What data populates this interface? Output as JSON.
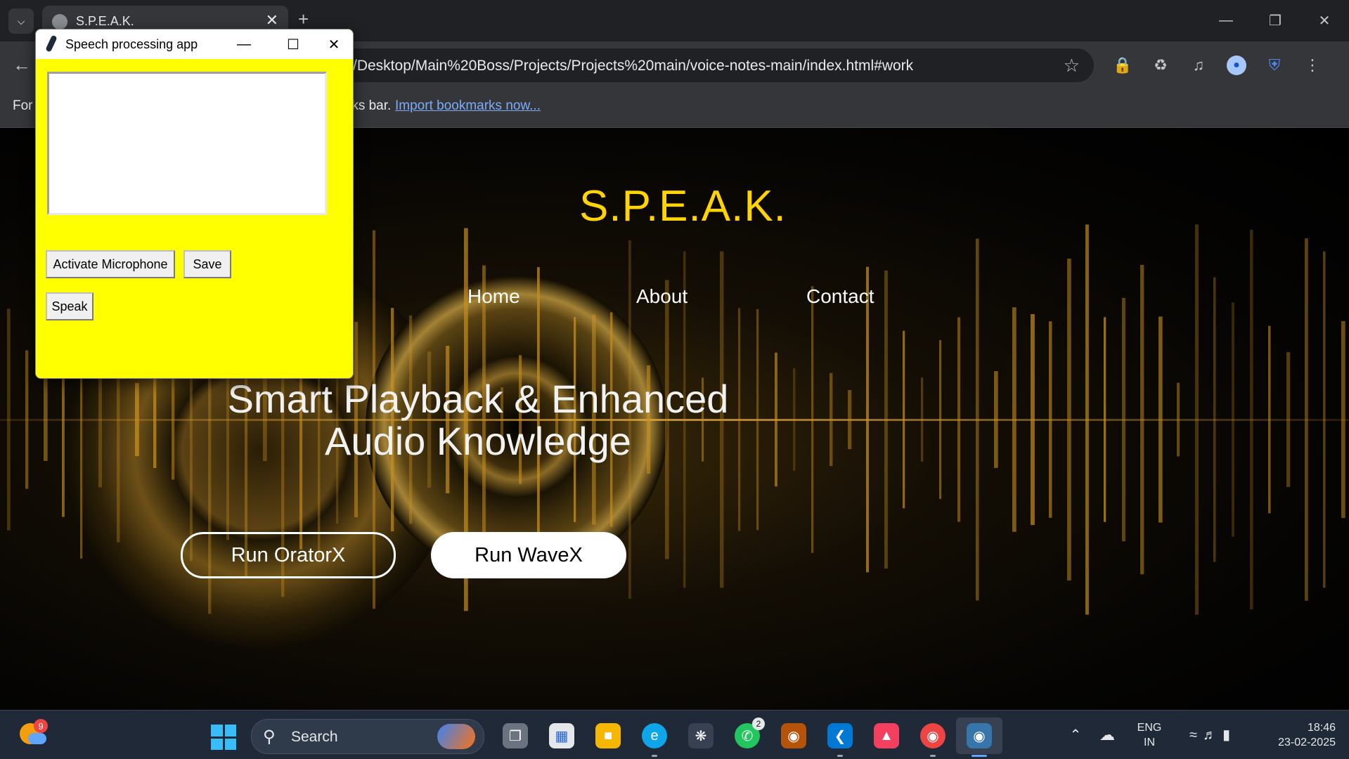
{
  "browser": {
    "tab_title": "S.P.E.A.K.",
    "tab_dropdown_icon": "chevron-down-icon",
    "new_tab_label": "+",
    "url": "/Desktop/Main%20Boss/Projects/Projects%20main/voice-notes-main/index.html#work",
    "bookmarks_prefix": "For",
    "bookmarks_suffix": "rks bar.",
    "bookmarks_link": "Import bookmarks now..."
  },
  "page": {
    "brand": "S.P.E.A.K.",
    "nav": [
      "Home",
      "About",
      "Contact"
    ],
    "hero_line1": "Smart Playback & Enhanced",
    "hero_line2": "Audio Knowledge",
    "btn_primary": "Run OratorX",
    "btn_secondary": "Run WaveX",
    "colors": {
      "brand": "#ffd400",
      "accent": "#c8901f"
    }
  },
  "tk_window": {
    "title": "Speech processing app",
    "textbox_value": "",
    "buttons": {
      "activate": "Activate Microphone",
      "save": "Save",
      "speak": "Speak"
    },
    "background": "#ffff00"
  },
  "taskbar": {
    "weather_badge": "9",
    "search_placeholder": "Search",
    "whatsapp_badge": "2",
    "lang_line1": "ENG",
    "lang_line2": "IN",
    "time": "18:46",
    "date": "23-02-2025"
  }
}
